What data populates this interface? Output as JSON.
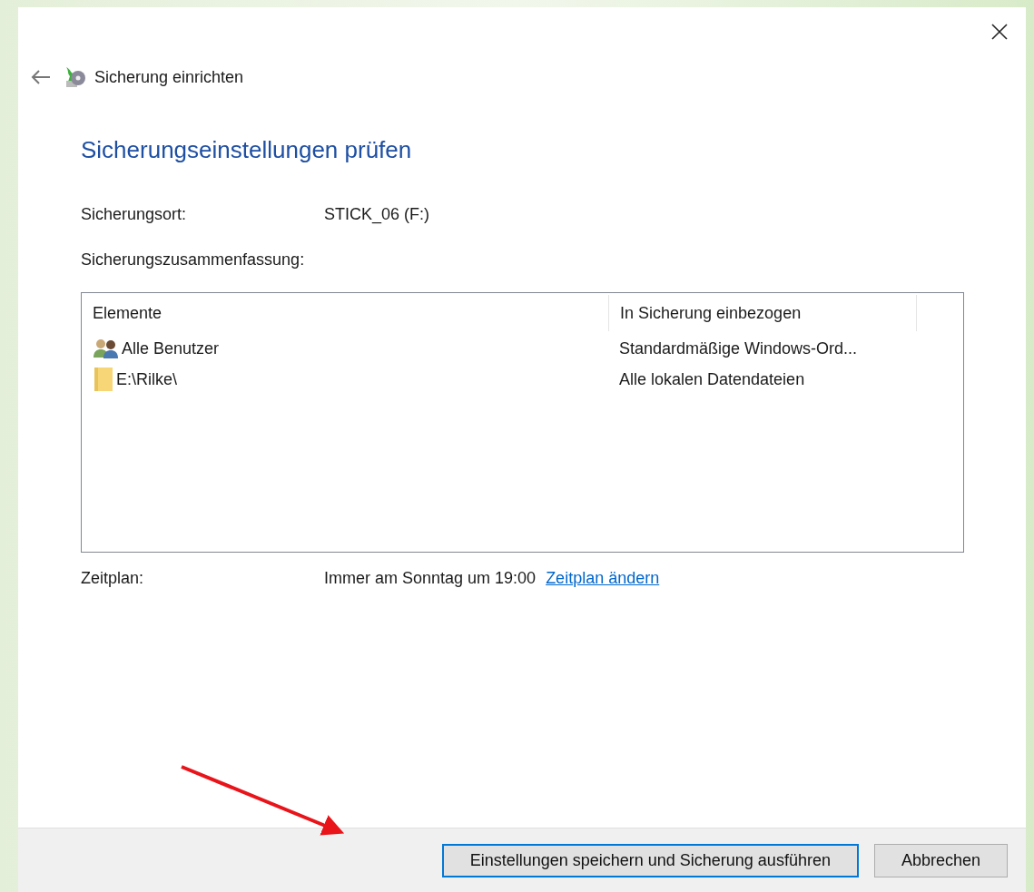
{
  "window": {
    "title": "Sicherung einrichten"
  },
  "heading": "Sicherungseinstellungen prüfen",
  "location": {
    "label": "Sicherungsort:",
    "value": "STICK_06 (F:)"
  },
  "summary": {
    "label": "Sicherungszusammenfassung:",
    "columns": [
      "Elemente",
      "In Sicherung einbezogen"
    ],
    "rows": [
      {
        "kind": "users",
        "name": "Alle Benutzer",
        "included": "Standardmäßige Windows-Ord..."
      },
      {
        "kind": "folder",
        "name": "E:\\Rilke\\",
        "included": "Alle lokalen Datendateien"
      }
    ]
  },
  "schedule": {
    "label": "Zeitplan:",
    "value": "Immer am Sonntag um 19:00",
    "link": "Zeitplan ändern"
  },
  "buttons": [
    {
      "label": "Einstellungen speichern und Sicherung ausführen",
      "default": true
    },
    {
      "label": "Abbrechen",
      "default": false
    }
  ]
}
